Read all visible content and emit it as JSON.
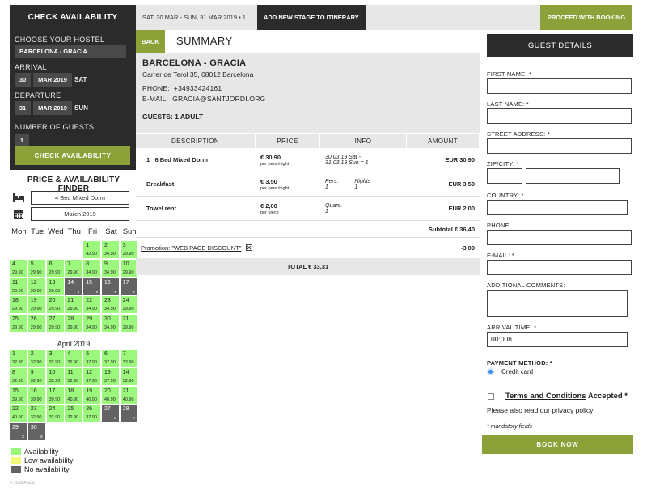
{
  "sidebar": {
    "title": "CHECK AVAILABILITY",
    "hostel_label": "CHOOSE YOUR HOSTEL",
    "hostel_value": "BARCELONA - GRACIA",
    "arrival_label": "ARRIVAL",
    "arrival_day": "30",
    "arrival_month": "MAR 2019",
    "arrival_dow": "SAT",
    "departure_label": "DEPARTURE",
    "departure_day": "31",
    "departure_month": "MAR 2019",
    "departure_dow": "SUN",
    "guests_label": "NUMBER OF GUESTS:",
    "guests_value": "1",
    "check_button": "CHECK AVAILABILITY"
  },
  "finder": {
    "title": "PRICE & AVAILABILITY FINDER",
    "room_icon": "bed-icon",
    "room_value": "4 Bed Mixed Dorm",
    "date_icon": "calendar-icon",
    "month_value": "March 2019",
    "weekdays": [
      "Mon",
      "Tue",
      "Wed",
      "Thu",
      "Fri",
      "Sat",
      "Sun"
    ],
    "march": [
      {
        "d": "",
        "p": "",
        "s": "empty"
      },
      {
        "d": "",
        "p": "",
        "s": "empty"
      },
      {
        "d": "",
        "p": "",
        "s": "empty"
      },
      {
        "d": "",
        "p": "",
        "s": "empty"
      },
      {
        "d": "1",
        "p": "42.90",
        "s": "avail"
      },
      {
        "d": "2",
        "p": "34.90",
        "s": "avail"
      },
      {
        "d": "3",
        "p": "29.90",
        "s": "avail"
      },
      {
        "d": "4",
        "p": "29.90",
        "s": "avail"
      },
      {
        "d": "5",
        "p": "29.90",
        "s": "avail"
      },
      {
        "d": "6",
        "p": "29.90",
        "s": "avail"
      },
      {
        "d": "7",
        "p": "29.90",
        "s": "avail"
      },
      {
        "d": "8",
        "p": "34.90",
        "s": "avail"
      },
      {
        "d": "9",
        "p": "34.90",
        "s": "avail"
      },
      {
        "d": "10",
        "p": "29.90",
        "s": "avail"
      },
      {
        "d": "11",
        "p": "29.90",
        "s": "avail"
      },
      {
        "d": "12",
        "p": "29.90",
        "s": "avail"
      },
      {
        "d": "13",
        "p": "29.90",
        "s": "avail"
      },
      {
        "d": "14",
        "p": "x",
        "s": "none"
      },
      {
        "d": "15",
        "p": "x",
        "s": "none"
      },
      {
        "d": "16",
        "p": "x",
        "s": "none"
      },
      {
        "d": "17",
        "p": "x",
        "s": "none"
      },
      {
        "d": "18",
        "p": "29.90",
        "s": "avail"
      },
      {
        "d": "19",
        "p": "29.90",
        "s": "avail"
      },
      {
        "d": "20",
        "p": "29.90",
        "s": "avail"
      },
      {
        "d": "21",
        "p": "29.90",
        "s": "avail"
      },
      {
        "d": "22",
        "p": "34.90",
        "s": "avail"
      },
      {
        "d": "23",
        "p": "34.90",
        "s": "avail"
      },
      {
        "d": "24",
        "p": "29.90",
        "s": "avail"
      },
      {
        "d": "25",
        "p": "29.90",
        "s": "avail"
      },
      {
        "d": "26",
        "p": "29.90",
        "s": "avail"
      },
      {
        "d": "27",
        "p": "29.90",
        "s": "avail"
      },
      {
        "d": "28",
        "p": "29.90",
        "s": "avail"
      },
      {
        "d": "29",
        "p": "34.90",
        "s": "avail"
      },
      {
        "d": "30",
        "p": "34.90",
        "s": "avail"
      },
      {
        "d": "31",
        "p": "29.90",
        "s": "avail"
      }
    ],
    "april_title": "April 2019",
    "april": [
      {
        "d": "1",
        "p": "32.90",
        "s": "avail"
      },
      {
        "d": "2",
        "p": "32.90",
        "s": "avail"
      },
      {
        "d": "3",
        "p": "32.90",
        "s": "avail"
      },
      {
        "d": "4",
        "p": "32.90",
        "s": "avail"
      },
      {
        "d": "5",
        "p": "37.90",
        "s": "avail"
      },
      {
        "d": "6",
        "p": "37.90",
        "s": "avail"
      },
      {
        "d": "7",
        "p": "32.90",
        "s": "avail"
      },
      {
        "d": "8",
        "p": "32.90",
        "s": "avail"
      },
      {
        "d": "9",
        "p": "32.90",
        "s": "avail"
      },
      {
        "d": "10",
        "p": "32.90",
        "s": "avail"
      },
      {
        "d": "11",
        "p": "32.90",
        "s": "avail"
      },
      {
        "d": "12",
        "p": "37.90",
        "s": "avail"
      },
      {
        "d": "13",
        "p": "37.90",
        "s": "avail"
      },
      {
        "d": "14",
        "p": "32.90",
        "s": "avail"
      },
      {
        "d": "15",
        "p": "39.90",
        "s": "avail"
      },
      {
        "d": "16",
        "p": "39.90",
        "s": "avail"
      },
      {
        "d": "17",
        "p": "39.90",
        "s": "avail"
      },
      {
        "d": "18",
        "p": "40.90",
        "s": "avail"
      },
      {
        "d": "19",
        "p": "40.90",
        "s": "avail"
      },
      {
        "d": "20",
        "p": "40.90",
        "s": "avail"
      },
      {
        "d": "21",
        "p": "40.90",
        "s": "avail"
      },
      {
        "d": "22",
        "p": "40.90",
        "s": "avail"
      },
      {
        "d": "23",
        "p": "32.90",
        "s": "avail"
      },
      {
        "d": "24",
        "p": "32.90",
        "s": "avail"
      },
      {
        "d": "25",
        "p": "32.90",
        "s": "avail"
      },
      {
        "d": "26",
        "p": "37.90",
        "s": "avail"
      },
      {
        "d": "27",
        "p": "x",
        "s": "none"
      },
      {
        "d": "28",
        "p": "x",
        "s": "none"
      },
      {
        "d": "29",
        "p": "x",
        "s": "none"
      },
      {
        "d": "30",
        "p": "x",
        "s": "none"
      }
    ],
    "legend": [
      {
        "label": "Availability",
        "color": "#9cf87c"
      },
      {
        "label": "Low availability",
        "color": "#f6f879"
      },
      {
        "label": "No availability",
        "color": "#636363"
      }
    ],
    "copyright": "© 2018 ASDD"
  },
  "topbar": {
    "stage_text": "SAT, 30 MAR - SUN, 31 MAR 2019 • 1",
    "add_stage": "ADD NEW STAGE TO ITINERARY",
    "proceed": "PROCEED WITH BOOKING"
  },
  "summary": {
    "back": "BACK",
    "title": "SUMMARY",
    "hostel_name": "BARCELONA - GRACIA",
    "address": "Carrer de Terol 35, 08012 Barcelona",
    "phone_label": "PHONE:",
    "phone": "+34933424161",
    "email_label": "E-MAIL:",
    "email": "GRACIA@SANTJORDI.ORG",
    "guests": "GUESTS: 1 ADULT",
    "columns": [
      "DESCRIPTION",
      "PRICE",
      "INFO",
      "AMOUNT"
    ],
    "rows": [
      {
        "qty": "1",
        "desc": "6 Bed Mixed Dorm",
        "price": "€ 30,90",
        "unit": "per pers./night",
        "info1": "30.03.19 Sat -",
        "info2": "31.03.19 Sun = 1",
        "info_b1": "",
        "info_b2": "",
        "amount": "EUR 30,90"
      },
      {
        "qty": "",
        "desc": "Breakfast",
        "price": "€ 3,50",
        "unit": "per pers./night",
        "info1": "Pers.",
        "info2": "1",
        "info_b1": "Nights",
        "info_b2": "1",
        "amount": "EUR 3,50"
      },
      {
        "qty": "",
        "desc": "Towel rent",
        "price": "€ 2,00",
        "unit": "per piece",
        "info1": "Quant.",
        "info2": "1",
        "info_b1": "",
        "info_b2": "",
        "amount": "EUR 2,00"
      }
    ],
    "subtotal": "Subtotal € 36,40",
    "promo_label": "Promotion: \"WEB PAGE DISCOUNT\"",
    "promo_value": "-3,09",
    "total": "TOTAL € 33,31"
  },
  "guest": {
    "title": "GUEST DETAILS",
    "first_name": "FIRST NAME: *",
    "last_name": "LAST NAME: *",
    "street": "STREET ADDRESS: *",
    "zip_city": "ZIP/CITY: *",
    "country": "COUNTRY: *",
    "phone": "PHONE:",
    "email": "E-MAIL: *",
    "comments": "ADDITIONAL COMMENTS:",
    "arrival_time": "ARRIVAL TIME: *",
    "arrival_time_value": "00:00h",
    "payment_label": "PAYMENT METHOD: *",
    "payment_option": "Credit card",
    "terms_link": "Terms and Conditions",
    "terms_suffix": " Accepted *",
    "privacy_prefix": "Please also read our ",
    "privacy_link": "privacy policy",
    "mandatory": "* mandatory fields",
    "book_now": "BOOK NOW"
  }
}
